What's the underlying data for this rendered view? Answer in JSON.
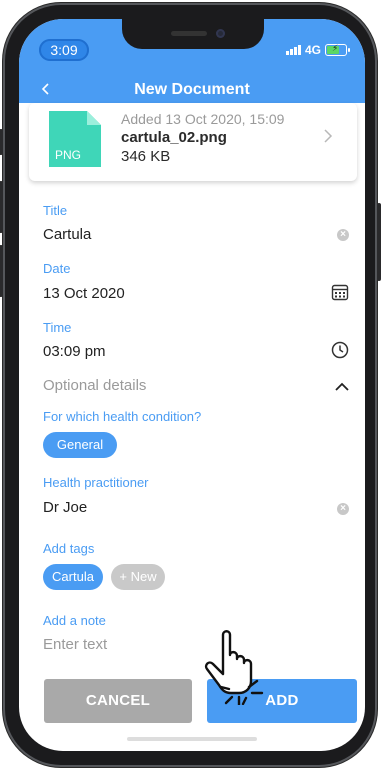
{
  "status": {
    "time": "3:09",
    "network": "4G"
  },
  "nav": {
    "back_icon": "chevron-left-icon",
    "title": "New Document"
  },
  "file": {
    "icon_label": "PNG",
    "added": "Added 13 Oct 2020, 15:09",
    "name": "cartula_02.png",
    "size": "346 KB"
  },
  "form": {
    "title_label": "Title",
    "title_value": "Cartula",
    "date_label": "Date",
    "date_value": "13 Oct 2020",
    "time_label": "Time",
    "time_value": "03:09 pm",
    "optional_label": "Optional details",
    "condition_label": "For which health condition?",
    "condition_chip": "General",
    "practitioner_label": "Health practitioner",
    "practitioner_value": "Dr Joe",
    "tags_label": "Add tags",
    "tags": [
      "Cartula"
    ],
    "new_tag": "+ New",
    "note_label": "Add a note",
    "note_placeholder": "Enter text"
  },
  "actions": {
    "cancel": "CANCEL",
    "add": "ADD"
  },
  "colors": {
    "accent": "#4a9cf3",
    "cancel": "#a9a9a9",
    "file_icon": "#3fd6b8"
  }
}
